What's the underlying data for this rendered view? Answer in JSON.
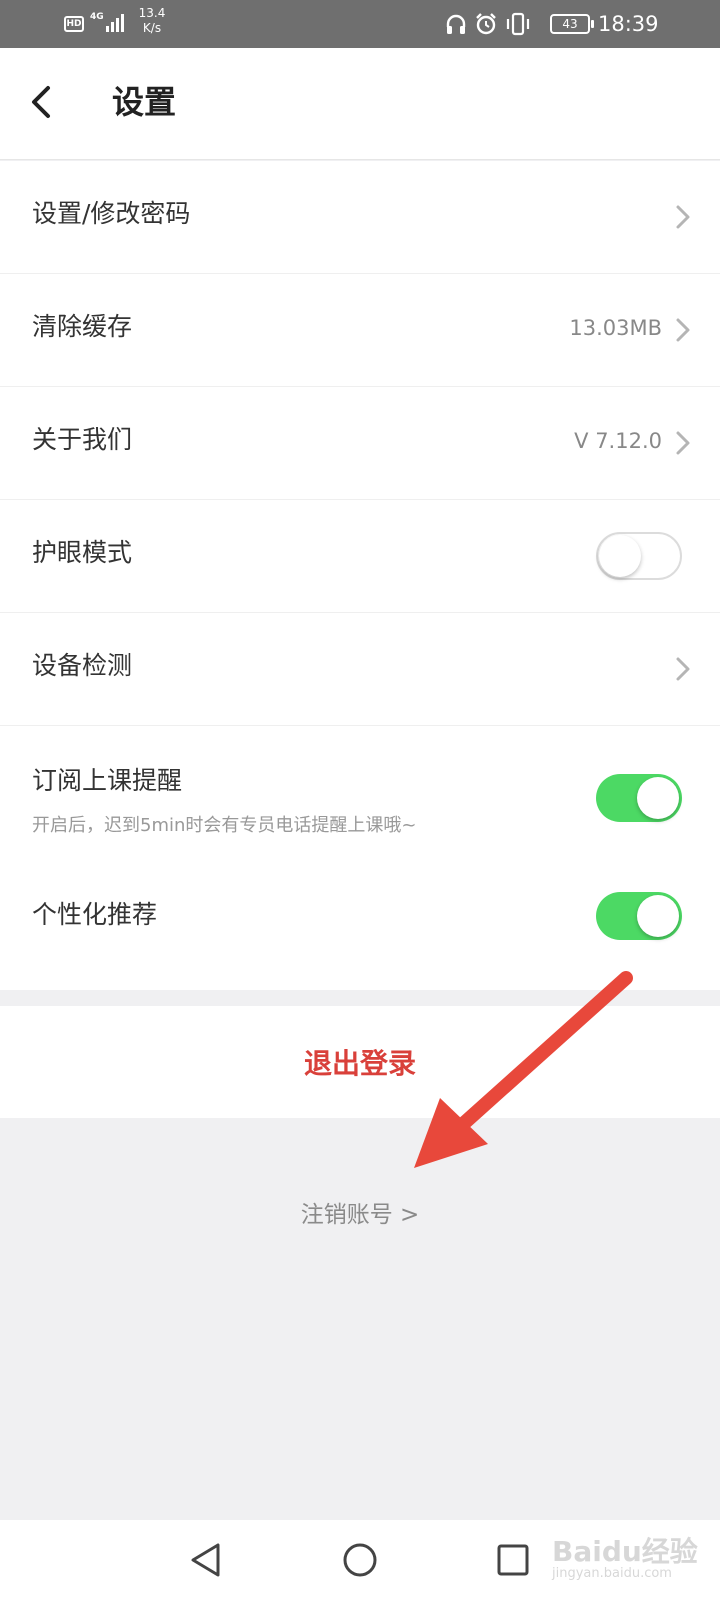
{
  "status_bar": {
    "hd_label": "HD",
    "network_label": "4G",
    "speed_value": "13.4",
    "speed_unit": "K/s",
    "battery": "43",
    "time": "18:39",
    "icons": [
      "signal-icon",
      "headphones-icon",
      "alarm-icon",
      "vibrate-icon",
      "battery-icon"
    ]
  },
  "header": {
    "title": "设置",
    "back_icon": "chevron-left-icon"
  },
  "settings": {
    "password": {
      "label": "设置/修改密码"
    },
    "cache": {
      "label": "清除缓存",
      "value": "13.03MB"
    },
    "about": {
      "label": "关于我们",
      "value": "V 7.12.0"
    },
    "eye_mode": {
      "label": "护眼模式",
      "enabled": false
    },
    "device_check": {
      "label": "设备检测"
    },
    "class_reminder": {
      "label": "订阅上课提醒",
      "description": "开启后，迟到5min时会有专员电话提醒上课哦~",
      "enabled": true
    },
    "personalized": {
      "label": "个性化推荐",
      "enabled": true
    }
  },
  "actions": {
    "logout_label": "退出登录",
    "cancel_account_label": "注销账号 >"
  },
  "colors": {
    "toggle_on": "#4cd964",
    "logout_red": "#d9403a",
    "annotation_red": "#e8483b",
    "status_bar": "#6f6f6f"
  },
  "watermark": {
    "text": "Baidu经验",
    "sub": "jingyan.baidu.com"
  }
}
